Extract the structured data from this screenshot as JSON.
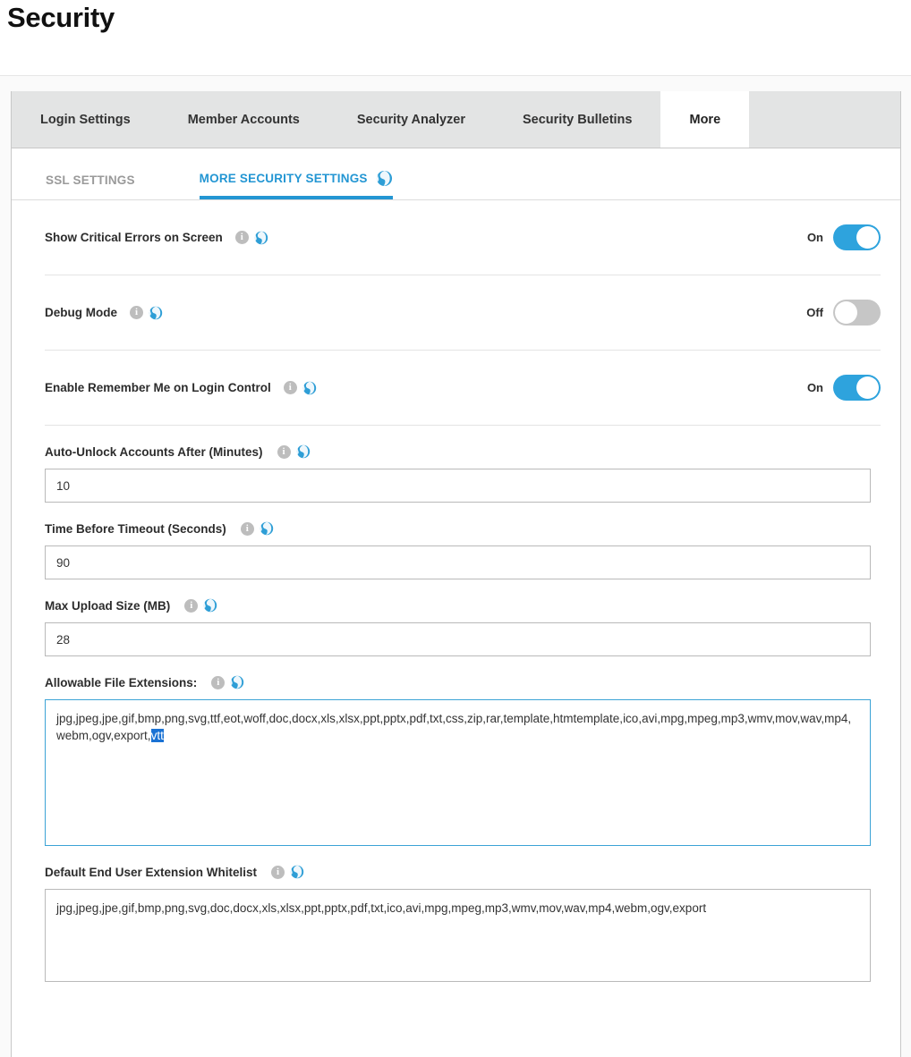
{
  "page": {
    "title": "Security"
  },
  "tabs": [
    {
      "label": "Login Settings",
      "active": false
    },
    {
      "label": "Member Accounts",
      "active": false
    },
    {
      "label": "Security Analyzer",
      "active": false
    },
    {
      "label": "Security Bulletins",
      "active": false
    },
    {
      "label": "More",
      "active": true
    }
  ],
  "subtabs": [
    {
      "label": "SSL SETTINGS",
      "active": false,
      "globe": false
    },
    {
      "label": "MORE SECURITY SETTINGS",
      "active": true,
      "globe": true
    }
  ],
  "toggles": [
    {
      "label": "Show Critical Errors on Screen",
      "state": "On",
      "on": true
    },
    {
      "label": "Debug Mode",
      "state": "Off",
      "on": false
    },
    {
      "label": "Enable Remember Me on Login Control",
      "state": "On",
      "on": true
    }
  ],
  "fields": [
    {
      "label": "Auto-Unlock Accounts After (Minutes)",
      "value": "10"
    },
    {
      "label": "Time Before Timeout (Seconds)",
      "value": "90"
    },
    {
      "label": "Max Upload Size (MB)",
      "value": "28"
    }
  ],
  "allowable_extensions": {
    "label": "Allowable File Extensions:",
    "value_prefix": "jpg,jpeg,jpe,gif,bmp,png,svg,ttf,eot,woff,doc,docx,xls,xlsx,ppt,pptx,pdf,txt,css,zip,rar,template,htmtemplate,ico,avi,mpg,mpeg,mp3,wmv,mov,wav,mp4,webm,ogv,export,",
    "value_selected": "vtt"
  },
  "default_whitelist": {
    "label": "Default End User Extension Whitelist",
    "value": "jpg,jpeg,jpe,gif,bmp,png,svg,doc,docx,xls,xlsx,ppt,pptx,pdf,txt,ico,avi,mpg,mpeg,mp3,wmv,mov,wav,mp4,webm,ogv,export"
  },
  "icons": {
    "info": "i",
    "info_name": "info-icon",
    "globe_name": "globe-localization-icon"
  },
  "colors": {
    "accent": "#2396d3",
    "toggle_on": "#2ea3dd",
    "toggle_off": "#c6c6c6",
    "selection": "#1a72d4",
    "tab_bg": "#e3e4e4"
  }
}
